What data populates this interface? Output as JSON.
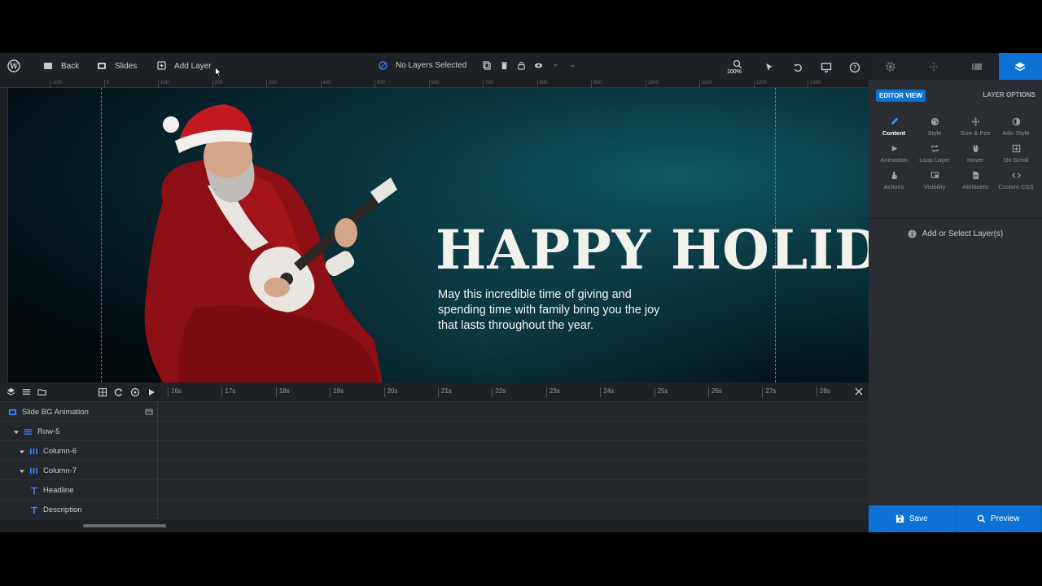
{
  "toolbar": {
    "back_label": "Back",
    "slides_label": "Slides",
    "add_layer_label": "Add Layer",
    "selection_status": "No Layers Selected",
    "zoom_level": "100%"
  },
  "ruler": {
    "marks": [
      "-100",
      "0",
      "100",
      "200",
      "300",
      "400",
      "500",
      "600",
      "700",
      "800",
      "900",
      "1000",
      "1100",
      "1200",
      "1300"
    ]
  },
  "slide": {
    "headline": "HAPPY HOLID.",
    "description": "May this incredible time of giving and spending time with family bring you the joy that lasts throughout the year."
  },
  "timeline": {
    "seconds": [
      "16s",
      "17s",
      "18s",
      "19s",
      "20s",
      "21s",
      "22s",
      "23s",
      "24s",
      "25s",
      "26s",
      "27s",
      "28s"
    ],
    "rows": [
      {
        "label": "Slide BG Animation",
        "icon": "slide-bg-icon"
      },
      {
        "label": "Row-5",
        "icon": "row-icon"
      },
      {
        "label": "Column-6",
        "icon": "column-icon"
      },
      {
        "label": "Column-7",
        "icon": "column-icon"
      },
      {
        "label": "Headline",
        "icon": "text-icon"
      },
      {
        "label": "Description",
        "icon": "text-icon"
      }
    ]
  },
  "panel": {
    "editor_view": "EDITOR VIEW",
    "layer_options": "LAYER OPTIONS",
    "options": [
      {
        "label": "Content",
        "icon": "pencil-icon",
        "active": true
      },
      {
        "label": "Style",
        "icon": "palette-icon",
        "active": false
      },
      {
        "label": "Size & Pos",
        "icon": "move-icon",
        "active": false
      },
      {
        "label": "Adv. Style",
        "icon": "contrast-icon",
        "active": false
      },
      {
        "label": "Animation",
        "icon": "play-icon",
        "active": false
      },
      {
        "label": "Loop Layer",
        "icon": "loop-icon",
        "active": false
      },
      {
        "label": "Hover",
        "icon": "mouse-icon",
        "active": false
      },
      {
        "label": "On Scroll",
        "icon": "scroll-icon",
        "active": false
      },
      {
        "label": "Actions",
        "icon": "hand-icon",
        "active": false
      },
      {
        "label": "Visibility",
        "icon": "visibility-icon",
        "active": false
      },
      {
        "label": "Attributes",
        "icon": "document-icon",
        "active": false
      },
      {
        "label": "Custom CSS",
        "icon": "code-icon",
        "active": false
      }
    ],
    "hint": "Add or Select Layer(s)",
    "save_label": "Save",
    "preview_label": "Preview"
  },
  "colors": {
    "accent": "#0d72d5",
    "toolbar_bg": "#1e2226",
    "panel_bg": "#2a2e33"
  }
}
